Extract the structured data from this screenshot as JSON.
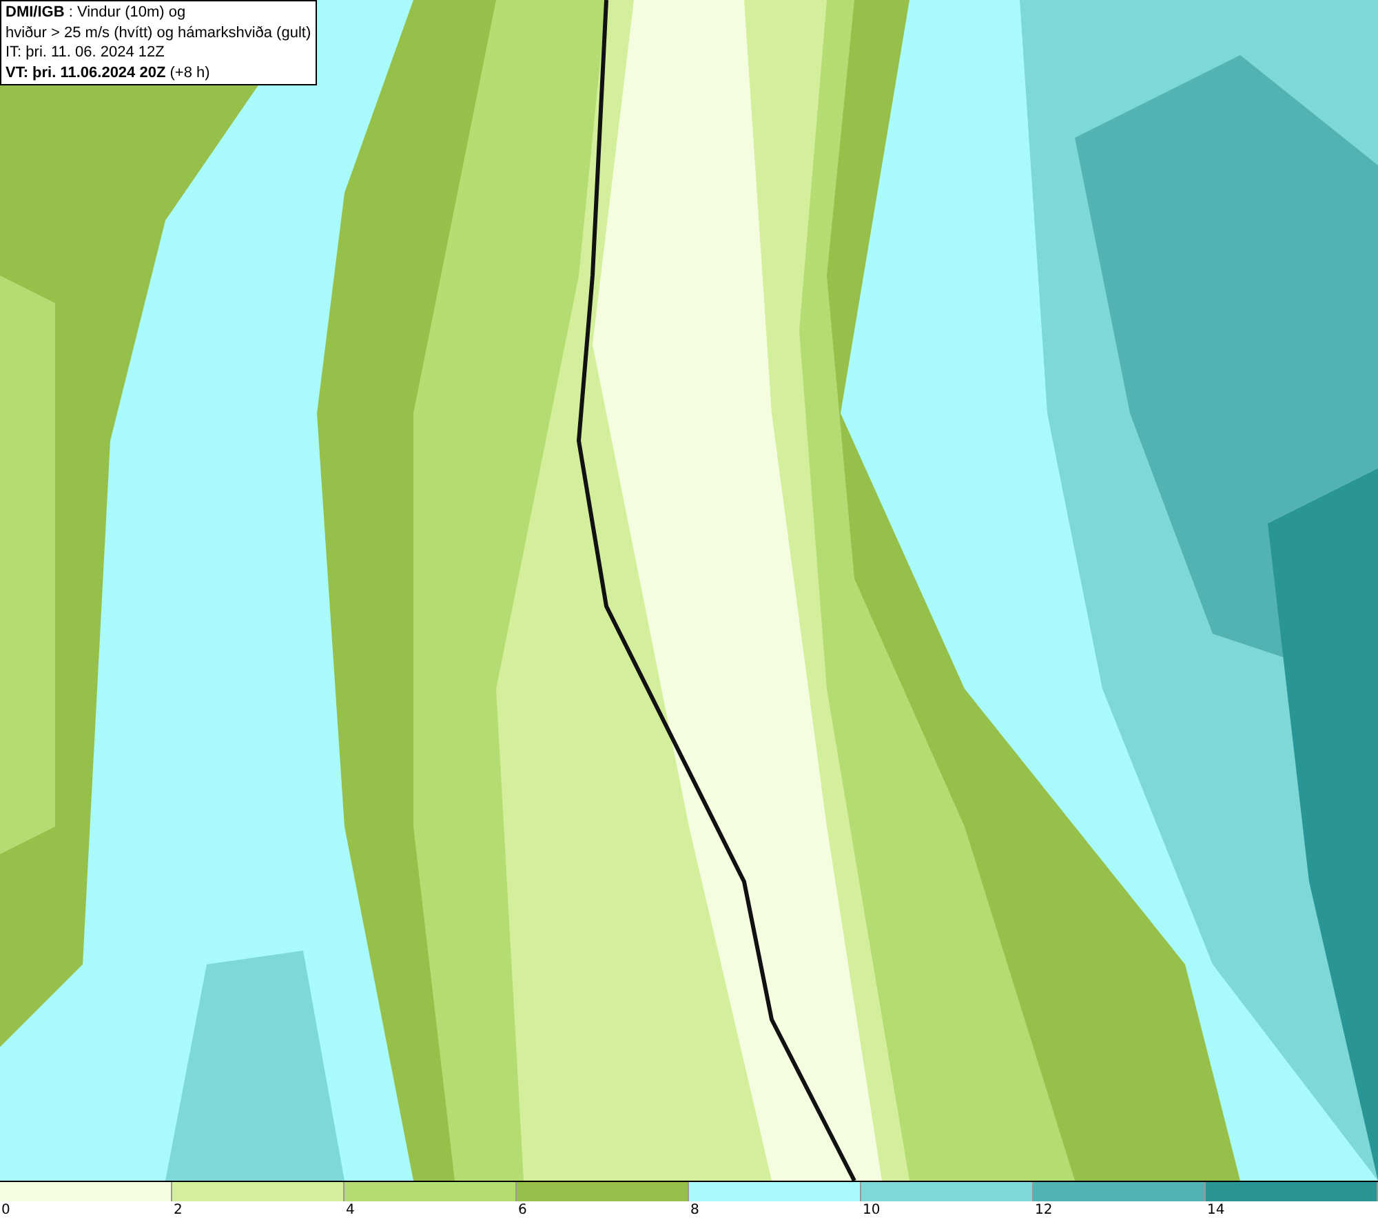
{
  "info_box": {
    "lines": [
      "**DMI/IGB** : Vindur (10m) og",
      "hviður > 25 m/s (hvítt) og hámarkshviða (gult)",
      "IT: þri. 11. 06. 2024 12Z",
      "**VT: þri. 11.06.2024 20Z** (+8 h)"
    ]
  },
  "legend": [
    {
      "label": "0",
      "color": "#f4fddf"
    },
    {
      "label": "2",
      "color": "#d3ef9b"
    },
    {
      "label": "4",
      "color": "#b5dc72"
    },
    {
      "label": "6",
      "color": "#97c04a"
    },
    {
      "label": "8",
      "color": "#a9fbfb"
    },
    {
      "label": "10",
      "color": "#7fd8d8"
    },
    {
      "label": "12",
      "color": "#53b3b3"
    },
    {
      "label": "14",
      "color": "#2a9595"
    }
  ]
}
